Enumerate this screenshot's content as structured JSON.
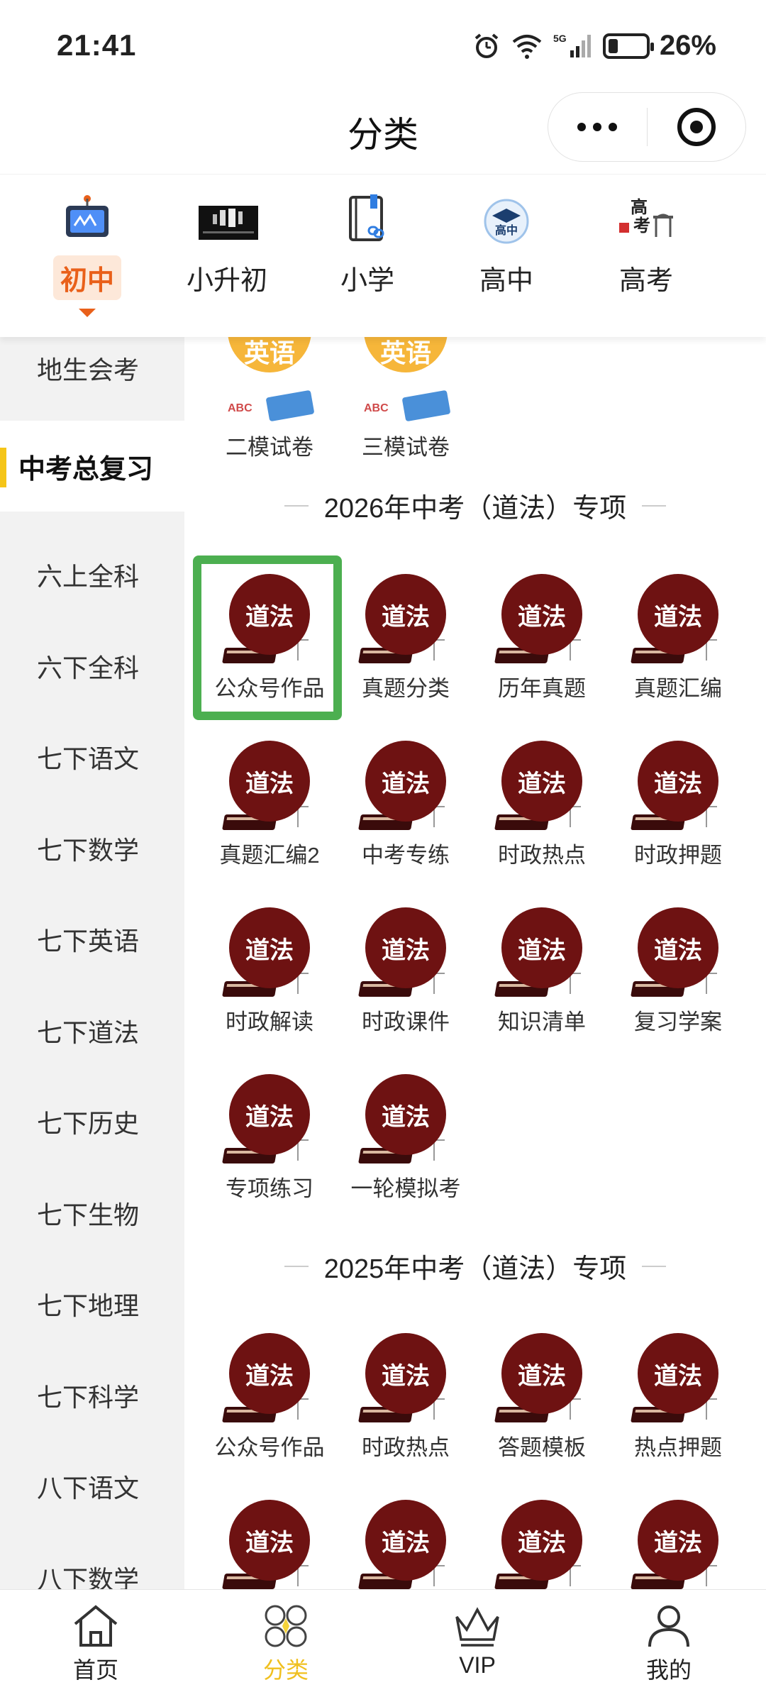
{
  "status_bar": {
    "time": "21:41",
    "battery_percent": "26%",
    "battery_level": 0.26,
    "network": "5G"
  },
  "header": {
    "title": "分类"
  },
  "top_tabs": [
    {
      "label": "初中",
      "icon": "tv-icon",
      "active": true
    },
    {
      "label": "小升初",
      "icon": "banner-image-icon",
      "active": false
    },
    {
      "label": "小学",
      "icon": "book-link-icon",
      "active": false
    },
    {
      "label": "高中",
      "icon": "graduation-cap-icon",
      "active": false
    },
    {
      "label": "高考",
      "icon": "gaokao-gate-icon",
      "active": false
    }
  ],
  "sidebar": {
    "items": [
      {
        "label": "地生会考",
        "active": false
      },
      {
        "label": "中考总复习",
        "active": true
      },
      {
        "label": "六上全科",
        "active": false
      },
      {
        "label": "六下全科",
        "active": false
      },
      {
        "label": "七下语文",
        "active": false
      },
      {
        "label": "七下数学",
        "active": false
      },
      {
        "label": "七下英语",
        "active": false
      },
      {
        "label": "七下道法",
        "active": false
      },
      {
        "label": "七下历史",
        "active": false
      },
      {
        "label": "七下生物",
        "active": false
      },
      {
        "label": "七下地理",
        "active": false
      },
      {
        "label": "七下科学",
        "active": false
      },
      {
        "label": "八下语文",
        "active": false
      },
      {
        "label": "八下数学",
        "active": false
      }
    ]
  },
  "main": {
    "top_items": [
      {
        "label": "二模试卷",
        "icon_text": "英语"
      },
      {
        "label": "三模试卷",
        "icon_text": "英语"
      }
    ],
    "sections": [
      {
        "title": "2026年中考（道法）专项",
        "items": [
          {
            "label": "公众号作品",
            "icon_text": "道法"
          },
          {
            "label": "真题分类",
            "icon_text": "道法"
          },
          {
            "label": "历年真题",
            "icon_text": "道法"
          },
          {
            "label": "真题汇编",
            "icon_text": "道法"
          },
          {
            "label": "真题汇编2",
            "icon_text": "道法"
          },
          {
            "label": "中考专练",
            "icon_text": "道法"
          },
          {
            "label": "时政热点",
            "icon_text": "道法"
          },
          {
            "label": "时政押题",
            "icon_text": "道法"
          },
          {
            "label": "时政解读",
            "icon_text": "道法"
          },
          {
            "label": "时政课件",
            "icon_text": "道法"
          },
          {
            "label": "知识清单",
            "icon_text": "道法"
          },
          {
            "label": "复习学案",
            "icon_text": "道法"
          },
          {
            "label": "专项练习",
            "icon_text": "道法"
          },
          {
            "label": "一轮模拟考",
            "icon_text": "道法"
          }
        ]
      },
      {
        "title": "2025年中考（道法）专项",
        "items": [
          {
            "label": "公众号作品",
            "icon_text": "道法"
          },
          {
            "label": "时政热点",
            "icon_text": "道法"
          },
          {
            "label": "答题模板",
            "icon_text": "道法"
          },
          {
            "label": "热点押题",
            "icon_text": "道法"
          },
          {
            "label": "",
            "icon_text": "道法"
          },
          {
            "label": "",
            "icon_text": "道法"
          },
          {
            "label": "",
            "icon_text": "道法"
          },
          {
            "label": "",
            "icon_text": "道法"
          }
        ]
      }
    ]
  },
  "bottom_nav": [
    {
      "label": "首页",
      "icon": "home-icon",
      "active": false
    },
    {
      "label": "分类",
      "icon": "category-icon",
      "active": true
    },
    {
      "label": "VIP",
      "icon": "crown-icon",
      "active": false
    },
    {
      "label": "我的",
      "icon": "user-icon",
      "active": false
    }
  ],
  "colors": {
    "accent_orange": "#e9601a",
    "accent_yellow": "#f5c518",
    "highlight_green": "#4caf50",
    "daofa_red": "#6e1212"
  }
}
